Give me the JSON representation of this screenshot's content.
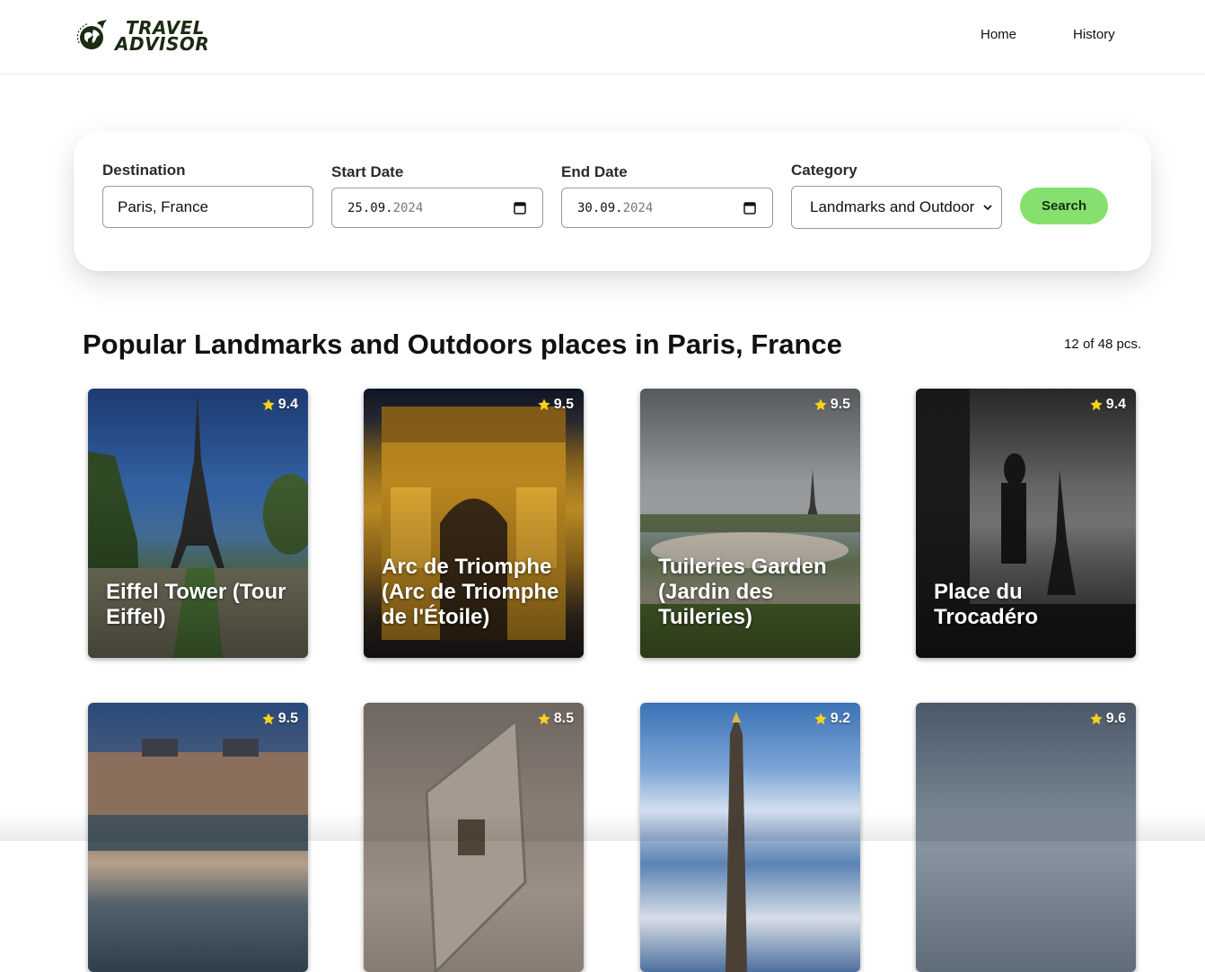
{
  "brand": {
    "line1": "TRAVEL",
    "line2": "ADVISOR",
    "icon": "globe-plane-icon"
  },
  "nav": {
    "home": "Home",
    "history": "History"
  },
  "search": {
    "destination_label": "Destination",
    "destination_value": "Paris, France",
    "start_label": "Start Date",
    "start_day_month": "25.09.",
    "start_year": "2024",
    "end_label": "End Date",
    "end_day_month": "30.09.",
    "end_year": "2024",
    "category_label": "Category",
    "category_value": "Landmarks and Outdoors",
    "button_label": "Search",
    "accent": "#86e06e"
  },
  "results": {
    "title": "Popular Landmarks and Outdoors places in Paris, France",
    "count": "12 of 48 pcs."
  },
  "cards": [
    {
      "title": "Eiffel Tower (Tour Eiffel)",
      "rating": "9.4"
    },
    {
      "title": "Arc de Triomphe (Arc de Triomphe de l'Étoile)",
      "rating": "9.5"
    },
    {
      "title": "Tuileries Garden (Jardin des Tuileries)",
      "rating": "9.5"
    },
    {
      "title": "Place du Trocadéro",
      "rating": "9.4"
    },
    {
      "title": "",
      "rating": "9.5"
    },
    {
      "title": "",
      "rating": "8.5"
    },
    {
      "title": "",
      "rating": "9.2"
    },
    {
      "title": "",
      "rating": "9.6"
    }
  ]
}
